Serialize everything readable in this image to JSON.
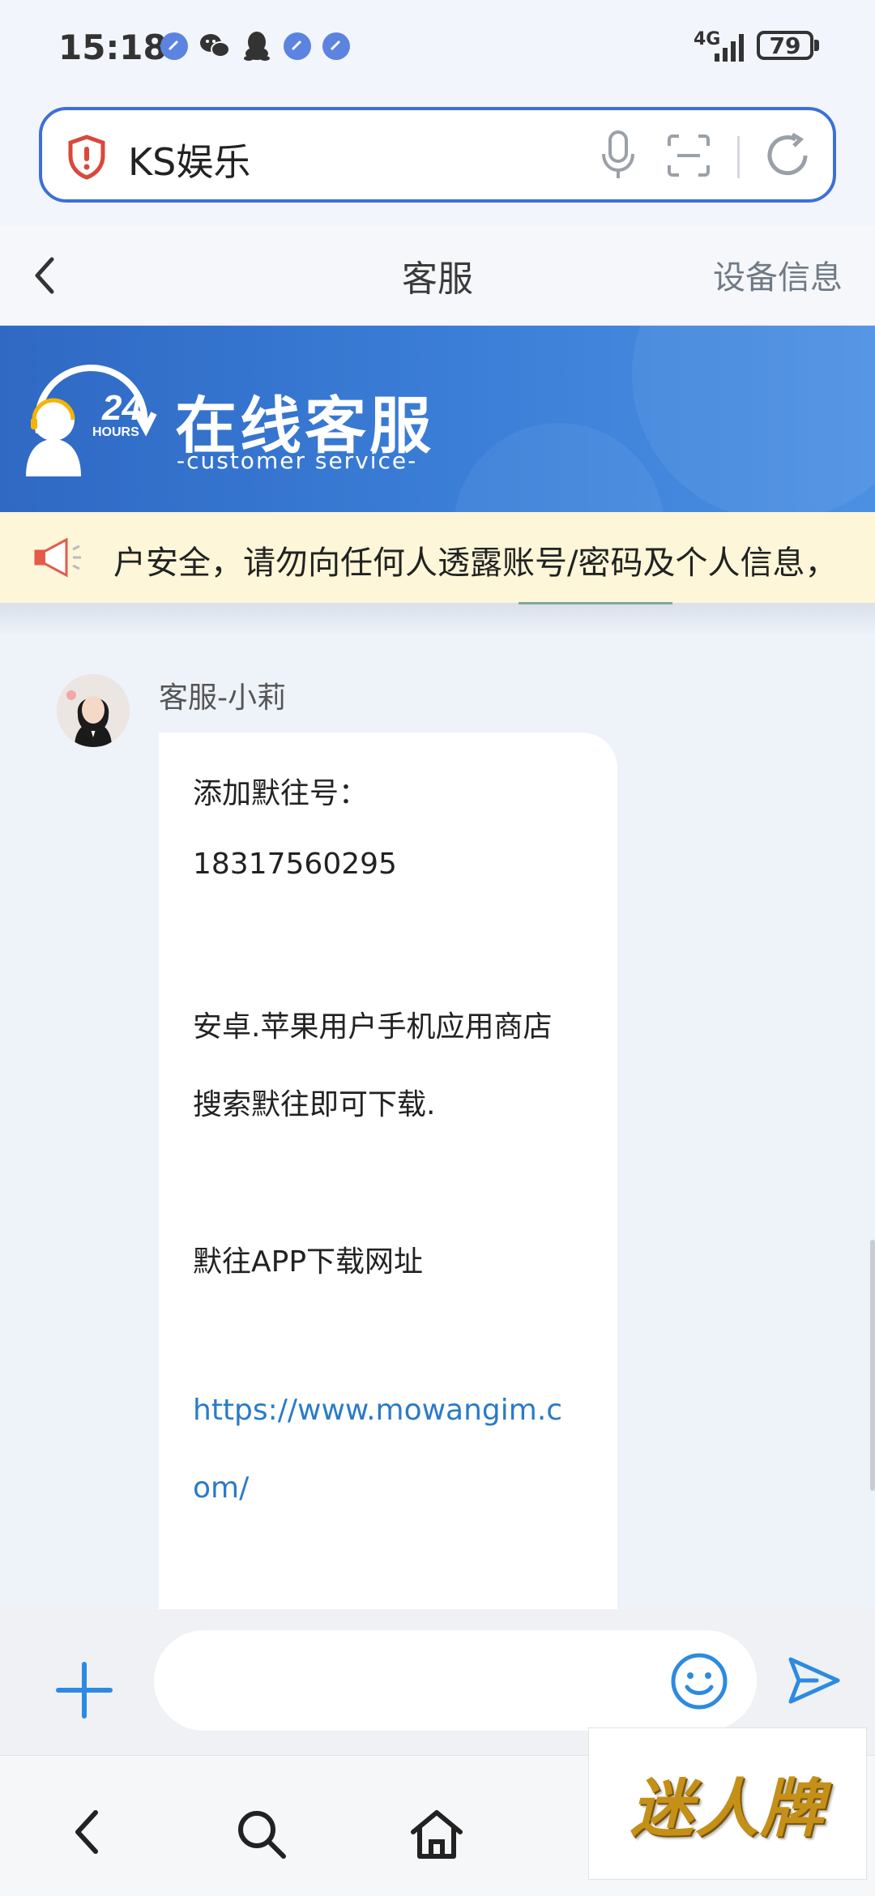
{
  "status_bar": {
    "time": "15:18",
    "network": "4G",
    "battery": "79"
  },
  "browser": {
    "url_text": "KS娱乐",
    "icons": [
      "shield-warning-icon",
      "microphone-icon",
      "scan-icon",
      "reload-icon"
    ]
  },
  "header": {
    "title": "客服",
    "device_info": "设备信息"
  },
  "banner": {
    "badge_number": "24",
    "badge_label": "HOURS",
    "title": "在线客服",
    "subtitle": "-customer service-"
  },
  "notice": {
    "text": "户安全，请勿向任何人透露账号/密码及个人信息，"
  },
  "chat": {
    "agent_name": "客服-小莉",
    "message_lines": [
      "添加默往号：",
      " 18317560295",
      "安卓.苹果用户手机应用商店",
      "搜索默往即可下载.",
      "默往APP下载网址",
      "https://www.mowangim.c",
      "om/"
    ]
  },
  "input_bar": {
    "placeholder": ""
  },
  "watermark": {
    "text": "迷人牌"
  },
  "colors": {
    "accent": "#3d6fd9",
    "banner": "#3b7fd8",
    "notice_bg": "#fdf6d8",
    "link": "#2a7bc7"
  }
}
